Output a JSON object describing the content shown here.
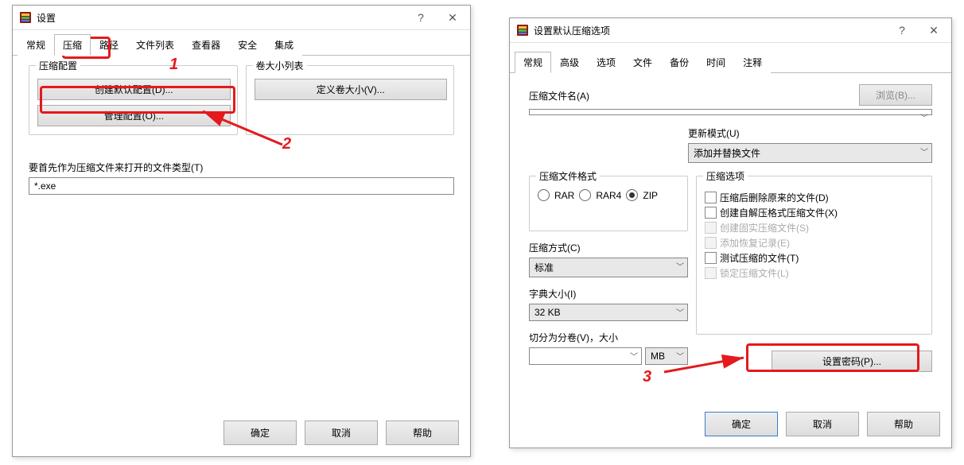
{
  "dialog1": {
    "title": "设置",
    "tabs": [
      "常规",
      "压缩",
      "路径",
      "文件列表",
      "查看器",
      "安全",
      "集成"
    ],
    "active_tab": "压缩",
    "group_compress_config": "压缩配置",
    "btn_create_default": "创建默认配置(D)...",
    "btn_manage_config": "管理配置(O)...",
    "group_volume_list": "卷大小列表",
    "btn_define_volume": "定义卷大小(V)...",
    "label_open_as_archive": "要首先作为压缩文件来打开的文件类型(T)",
    "input_open_as_archive": "*.exe",
    "btn_ok": "确定",
    "btn_cancel": "取消",
    "btn_help": "帮助"
  },
  "dialog2": {
    "title": "设置默认压缩选项",
    "tabs": [
      "常规",
      "高级",
      "选项",
      "文件",
      "备份",
      "时间",
      "注释"
    ],
    "active_tab": "常规",
    "label_archive_name": "压缩文件名(A)",
    "btn_browse": "浏览(B)...",
    "archive_name_value": "",
    "label_update_mode": "更新模式(U)",
    "update_mode_value": "添加并替换文件",
    "group_format": "压缩文件格式",
    "radio_rar": "RAR",
    "radio_rar4": "RAR4",
    "radio_zip": "ZIP",
    "group_options": "压缩选项",
    "chk_delete_after": "压缩后删除原来的文件(D)",
    "chk_create_sfx": "创建自解压格式压缩文件(X)",
    "chk_create_solid": "创建固实压缩文件(S)",
    "chk_add_recovery": "添加恢复记录(E)",
    "chk_test": "测试压缩的文件(T)",
    "chk_lock": "锁定压缩文件(L)",
    "label_method": "压缩方式(C)",
    "method_value": "标准",
    "label_dict": "字典大小(I)",
    "dict_value": "32 KB",
    "label_split": "切分为分卷(V)，大小",
    "split_value": "",
    "split_unit": "MB",
    "btn_set_password": "设置密码(P)...",
    "btn_ok": "确定",
    "btn_cancel": "取消",
    "btn_help": "帮助"
  },
  "annotations": {
    "num1": "1",
    "num2": "2",
    "num3": "3"
  }
}
